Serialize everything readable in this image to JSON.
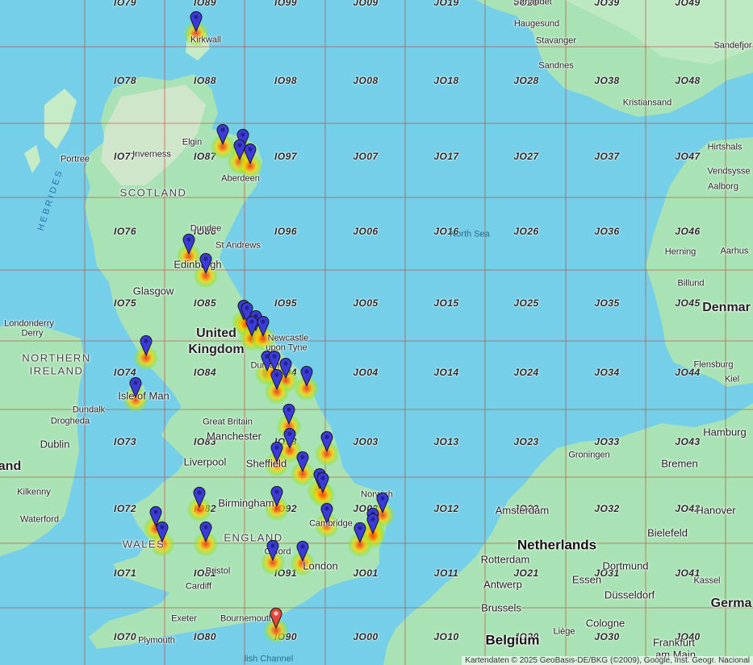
{
  "map": {
    "grid_labels": [
      {
        "t": "IO79",
        "c": 2,
        "r": 0
      },
      {
        "t": "IO89",
        "c": 3,
        "r": 0
      },
      {
        "t": "IO99",
        "c": 4,
        "r": 0
      },
      {
        "t": "JO09",
        "c": 5,
        "r": 0
      },
      {
        "t": "JO19",
        "c": 6,
        "r": 0
      },
      {
        "t": "JO29",
        "c": 7,
        "r": 0
      },
      {
        "t": "JO39",
        "c": 8,
        "r": 0
      },
      {
        "t": "JO49",
        "c": 9,
        "r": 0
      },
      {
        "t": "IO78",
        "c": 2,
        "r": 1
      },
      {
        "t": "IO88",
        "c": 3,
        "r": 1
      },
      {
        "t": "IO98",
        "c": 4,
        "r": 1
      },
      {
        "t": "JO08",
        "c": 5,
        "r": 1
      },
      {
        "t": "JO18",
        "c": 6,
        "r": 1
      },
      {
        "t": "JO28",
        "c": 7,
        "r": 1
      },
      {
        "t": "JO38",
        "c": 8,
        "r": 1
      },
      {
        "t": "JO48",
        "c": 9,
        "r": 1
      },
      {
        "t": "IO77",
        "c": 2,
        "r": 2
      },
      {
        "t": "IO87",
        "c": 3,
        "r": 2
      },
      {
        "t": "IO97",
        "c": 4,
        "r": 2
      },
      {
        "t": "JO07",
        "c": 5,
        "r": 2
      },
      {
        "t": "JO17",
        "c": 6,
        "r": 2
      },
      {
        "t": "JO27",
        "c": 7,
        "r": 2
      },
      {
        "t": "JO37",
        "c": 8,
        "r": 2
      },
      {
        "t": "JO47",
        "c": 9,
        "r": 2
      },
      {
        "t": "IO76",
        "c": 2,
        "r": 3
      },
      {
        "t": "IO86",
        "c": 3,
        "r": 3
      },
      {
        "t": "IO96",
        "c": 4,
        "r": 3
      },
      {
        "t": "JO06",
        "c": 5,
        "r": 3
      },
      {
        "t": "JO16",
        "c": 6,
        "r": 3
      },
      {
        "t": "JO26",
        "c": 7,
        "r": 3
      },
      {
        "t": "JO36",
        "c": 8,
        "r": 3
      },
      {
        "t": "JO46",
        "c": 9,
        "r": 3
      },
      {
        "t": "IO75",
        "c": 2,
        "r": 4
      },
      {
        "t": "IO85",
        "c": 3,
        "r": 4
      },
      {
        "t": "IO95",
        "c": 4,
        "r": 4
      },
      {
        "t": "JO05",
        "c": 5,
        "r": 4
      },
      {
        "t": "JO15",
        "c": 6,
        "r": 4
      },
      {
        "t": "JO25",
        "c": 7,
        "r": 4
      },
      {
        "t": "JO35",
        "c": 8,
        "r": 4
      },
      {
        "t": "JO45",
        "c": 9,
        "r": 4
      },
      {
        "t": "IO74",
        "c": 2,
        "r": 5
      },
      {
        "t": "IO84",
        "c": 3,
        "r": 5
      },
      {
        "t": "IO94",
        "c": 4,
        "r": 5
      },
      {
        "t": "JO04",
        "c": 5,
        "r": 5
      },
      {
        "t": "JO14",
        "c": 6,
        "r": 5
      },
      {
        "t": "JO24",
        "c": 7,
        "r": 5
      },
      {
        "t": "JO34",
        "c": 8,
        "r": 5
      },
      {
        "t": "JO44",
        "c": 9,
        "r": 5
      },
      {
        "t": "IO73",
        "c": 2,
        "r": 6
      },
      {
        "t": "IO83",
        "c": 3,
        "r": 6
      },
      {
        "t": "IO93",
        "c": 4,
        "r": 6
      },
      {
        "t": "JO03",
        "c": 5,
        "r": 6
      },
      {
        "t": "JO13",
        "c": 6,
        "r": 6
      },
      {
        "t": "JO23",
        "c": 7,
        "r": 6
      },
      {
        "t": "JO33",
        "c": 8,
        "r": 6
      },
      {
        "t": "JO43",
        "c": 9,
        "r": 6
      },
      {
        "t": "IO72",
        "c": 2,
        "r": 7
      },
      {
        "t": "IO82",
        "c": 3,
        "r": 7
      },
      {
        "t": "IO92",
        "c": 4,
        "r": 7
      },
      {
        "t": "JO02",
        "c": 5,
        "r": 7
      },
      {
        "t": "JO12",
        "c": 6,
        "r": 7
      },
      {
        "t": "JO22",
        "c": 7,
        "r": 7
      },
      {
        "t": "JO32",
        "c": 8,
        "r": 7
      },
      {
        "t": "JO42",
        "c": 9,
        "r": 7
      },
      {
        "t": "IO71",
        "c": 2,
        "r": 8
      },
      {
        "t": "IO81",
        "c": 3,
        "r": 8
      },
      {
        "t": "IO91",
        "c": 4,
        "r": 8
      },
      {
        "t": "JO01",
        "c": 5,
        "r": 8
      },
      {
        "t": "JO11",
        "c": 6,
        "r": 8
      },
      {
        "t": "JO21",
        "c": 7,
        "r": 8
      },
      {
        "t": "JO31",
        "c": 8,
        "r": 8
      },
      {
        "t": "JO41",
        "c": 9,
        "r": 8
      },
      {
        "t": "IO70",
        "c": 2,
        "r": 9
      },
      {
        "t": "IO80",
        "c": 3,
        "r": 9
      },
      {
        "t": "IO90",
        "c": 4,
        "r": 9
      },
      {
        "t": "JO00",
        "c": 5,
        "r": 9
      },
      {
        "t": "JO10",
        "c": 6,
        "r": 9
      },
      {
        "t": "JO20",
        "c": 7,
        "r": 9
      },
      {
        "t": "JO30",
        "c": 8,
        "r": 9
      },
      {
        "t": "JO40",
        "c": 9,
        "r": 9
      }
    ],
    "places": [
      {
        "id": "kirkwall",
        "name": "Kirkwall",
        "size": "s"
      },
      {
        "id": "elgin",
        "name": "Elgin",
        "size": "s"
      },
      {
        "id": "inverness",
        "name": "Inverness",
        "size": "s"
      },
      {
        "id": "portree",
        "name": "Portree",
        "size": "s"
      },
      {
        "id": "aberdeen",
        "name": "Aberdeen",
        "size": "s"
      },
      {
        "id": "scotland",
        "name": "SCOTLAND",
        "size": "region"
      },
      {
        "id": "hebrides",
        "name": "HEBRIDES",
        "size": "heb"
      },
      {
        "id": "dundee",
        "name": "Dundee",
        "size": "s"
      },
      {
        "id": "standrews",
        "name": "St Andrews",
        "size": "s"
      },
      {
        "id": "edinburgh",
        "name": "Edinburgh",
        "size": "m"
      },
      {
        "id": "glasgow",
        "name": "Glasgow",
        "size": "m"
      },
      {
        "id": "londonderry",
        "name": "Londonderry",
        "size": "s"
      },
      {
        "id": "derry",
        "name": "Derry",
        "size": "s"
      },
      {
        "id": "northern",
        "name": "NORTHERN",
        "size": "region"
      },
      {
        "id": "ireland",
        "name": "IRELAND",
        "size": "region"
      },
      {
        "id": "uk1",
        "name": "United",
        "size": "l"
      },
      {
        "id": "uk2",
        "name": "Kingdom",
        "size": "l"
      },
      {
        "id": "newcastle1",
        "name": "Newcastle",
        "size": "s"
      },
      {
        "id": "newcastle2",
        "name": "upon Tyne",
        "size": "s"
      },
      {
        "id": "durham",
        "name": "Durham",
        "size": "s"
      },
      {
        "id": "isleofman",
        "name": "Isle of Man",
        "size": "m"
      },
      {
        "id": "dundalk",
        "name": "Dundalk",
        "size": "s"
      },
      {
        "id": "drogheda",
        "name": "Drogheda",
        "size": "s"
      },
      {
        "id": "greatbritain",
        "name": "Great Britain",
        "size": "s"
      },
      {
        "id": "manchester",
        "name": "Manchester",
        "size": "m"
      },
      {
        "id": "dublin",
        "name": "Dublin",
        "size": "m"
      },
      {
        "id": "liverpool",
        "name": "Liverpool",
        "size": "m"
      },
      {
        "id": "sheffield",
        "name": "Sheffield",
        "size": "m"
      },
      {
        "id": "ireland2",
        "name": "and",
        "size": "l"
      },
      {
        "id": "kilkenny",
        "name": "Kilkenny",
        "size": "s"
      },
      {
        "id": "waterford",
        "name": "Waterford",
        "size": "s"
      },
      {
        "id": "birmingham",
        "name": "Birmingham",
        "size": "m"
      },
      {
        "id": "norwich",
        "name": "Norwich",
        "size": "s"
      },
      {
        "id": "england",
        "name": "ENGLAND",
        "size": "region"
      },
      {
        "id": "cambridge",
        "name": "Cambridge",
        "size": "s"
      },
      {
        "id": "wales",
        "name": "WALES",
        "size": "region"
      },
      {
        "id": "oxford",
        "name": "Oxford",
        "size": "s"
      },
      {
        "id": "london",
        "name": "London",
        "size": "m"
      },
      {
        "id": "bristol",
        "name": "Bristol",
        "size": "s"
      },
      {
        "id": "cardiff",
        "name": "Cardiff",
        "size": "s"
      },
      {
        "id": "exeter",
        "name": "Exeter",
        "size": "s"
      },
      {
        "id": "bournemouth",
        "name": "Bournemouth",
        "size": "s"
      },
      {
        "id": "plymouth",
        "name": "Plymouth",
        "size": "s"
      },
      {
        "id": "channel",
        "name": "lish Channel",
        "size": "sea"
      },
      {
        "id": "northsea",
        "name": "North Sea",
        "size": "sea"
      },
      {
        "id": "norway",
        "name": "Sørlandet",
        "size": "s"
      },
      {
        "id": "haugesund",
        "name": "Haugesund",
        "size": "s"
      },
      {
        "id": "stavanger",
        "name": "Stavanger",
        "size": "s"
      },
      {
        "id": "sandnes",
        "name": "Sandnes",
        "size": "s"
      },
      {
        "id": "kristiansand",
        "name": "Kristiansand",
        "size": "s"
      },
      {
        "id": "sandefjord",
        "name": "Sandefjor",
        "size": "s"
      },
      {
        "id": "hirtshals",
        "name": "Hirtshals",
        "size": "s"
      },
      {
        "id": "vendsyssel",
        "name": "Vendsysse",
        "size": "s"
      },
      {
        "id": "aalborg",
        "name": "Aalborg",
        "size": "s"
      },
      {
        "id": "herning",
        "name": "Herning",
        "size": "s"
      },
      {
        "id": "aarhus",
        "name": "Aarhus",
        "size": "s"
      },
      {
        "id": "billund",
        "name": "Billund",
        "size": "s"
      },
      {
        "id": "denmark",
        "name": "Denmar",
        "size": "l"
      },
      {
        "id": "flensburg",
        "name": "Flensburg",
        "size": "s"
      },
      {
        "id": "kiel",
        "name": "Kiel",
        "size": "s"
      },
      {
        "id": "hamburg",
        "name": "Hamburg",
        "size": "m"
      },
      {
        "id": "groningen",
        "name": "Groningen",
        "size": "s"
      },
      {
        "id": "bremen",
        "name": "Bremen",
        "size": "m"
      },
      {
        "id": "amsterdam",
        "name": "Amsterdam",
        "size": "m"
      },
      {
        "id": "hanover",
        "name": "Hanover",
        "size": "m"
      },
      {
        "id": "netherlands",
        "name": "Netherlands",
        "size": "xl"
      },
      {
        "id": "bielefeld",
        "name": "Bielefeld",
        "size": "m"
      },
      {
        "id": "rotterdam",
        "name": "Rotterdam",
        "size": "m"
      },
      {
        "id": "dortmund",
        "name": "Dortmund",
        "size": "m"
      },
      {
        "id": "antwerp",
        "name": "Antwerp",
        "size": "m"
      },
      {
        "id": "essen",
        "name": "Essen",
        "size": "m"
      },
      {
        "id": "kassel",
        "name": "Kassel",
        "size": "s"
      },
      {
        "id": "brussels",
        "name": "Brussels",
        "size": "m"
      },
      {
        "id": "dusseldorf",
        "name": "Düsseldorf",
        "size": "m"
      },
      {
        "id": "germany",
        "name": "Germa",
        "size": "l"
      },
      {
        "id": "cologne",
        "name": "Cologne",
        "size": "m"
      },
      {
        "id": "belgium",
        "name": "Belgium",
        "size": "xl"
      },
      {
        "id": "liege",
        "name": "Liège",
        "size": "s"
      },
      {
        "id": "frankfurt1",
        "name": "Frankfurt",
        "size": "m"
      },
      {
        "id": "frankfurt2",
        "name": "am Main",
        "size": "m"
      }
    ],
    "pins": [
      "blue",
      "blue",
      "blue",
      "blue",
      "blue",
      "blue",
      "blue",
      "blue",
      "blue",
      "blue",
      "blue",
      "blue",
      "blue",
      "blue",
      "blue",
      "blue",
      "blue",
      "blue",
      "blue",
      "blue",
      "blue",
      "blue",
      "blue",
      "blue",
      "blue",
      "blue",
      "blue",
      "blue",
      "blue",
      "blue",
      "blue",
      "blue",
      "blue",
      "blue",
      "blue",
      "blue",
      "blue",
      "blue",
      "red"
    ],
    "colors": {
      "sea": "#75cfe9",
      "land": "#a9e3b5",
      "land_dark": "#c6ebc7",
      "mountain": "#d9e6d0",
      "grid": "#c0392b",
      "pin_blue": "#3b3bdb",
      "pin_red": "#e8483b"
    },
    "attribution": "Kartendaten © 2025 GeoBasis-DE/BKG (©2009), Google, Inst. Geogr. Nacional"
  }
}
